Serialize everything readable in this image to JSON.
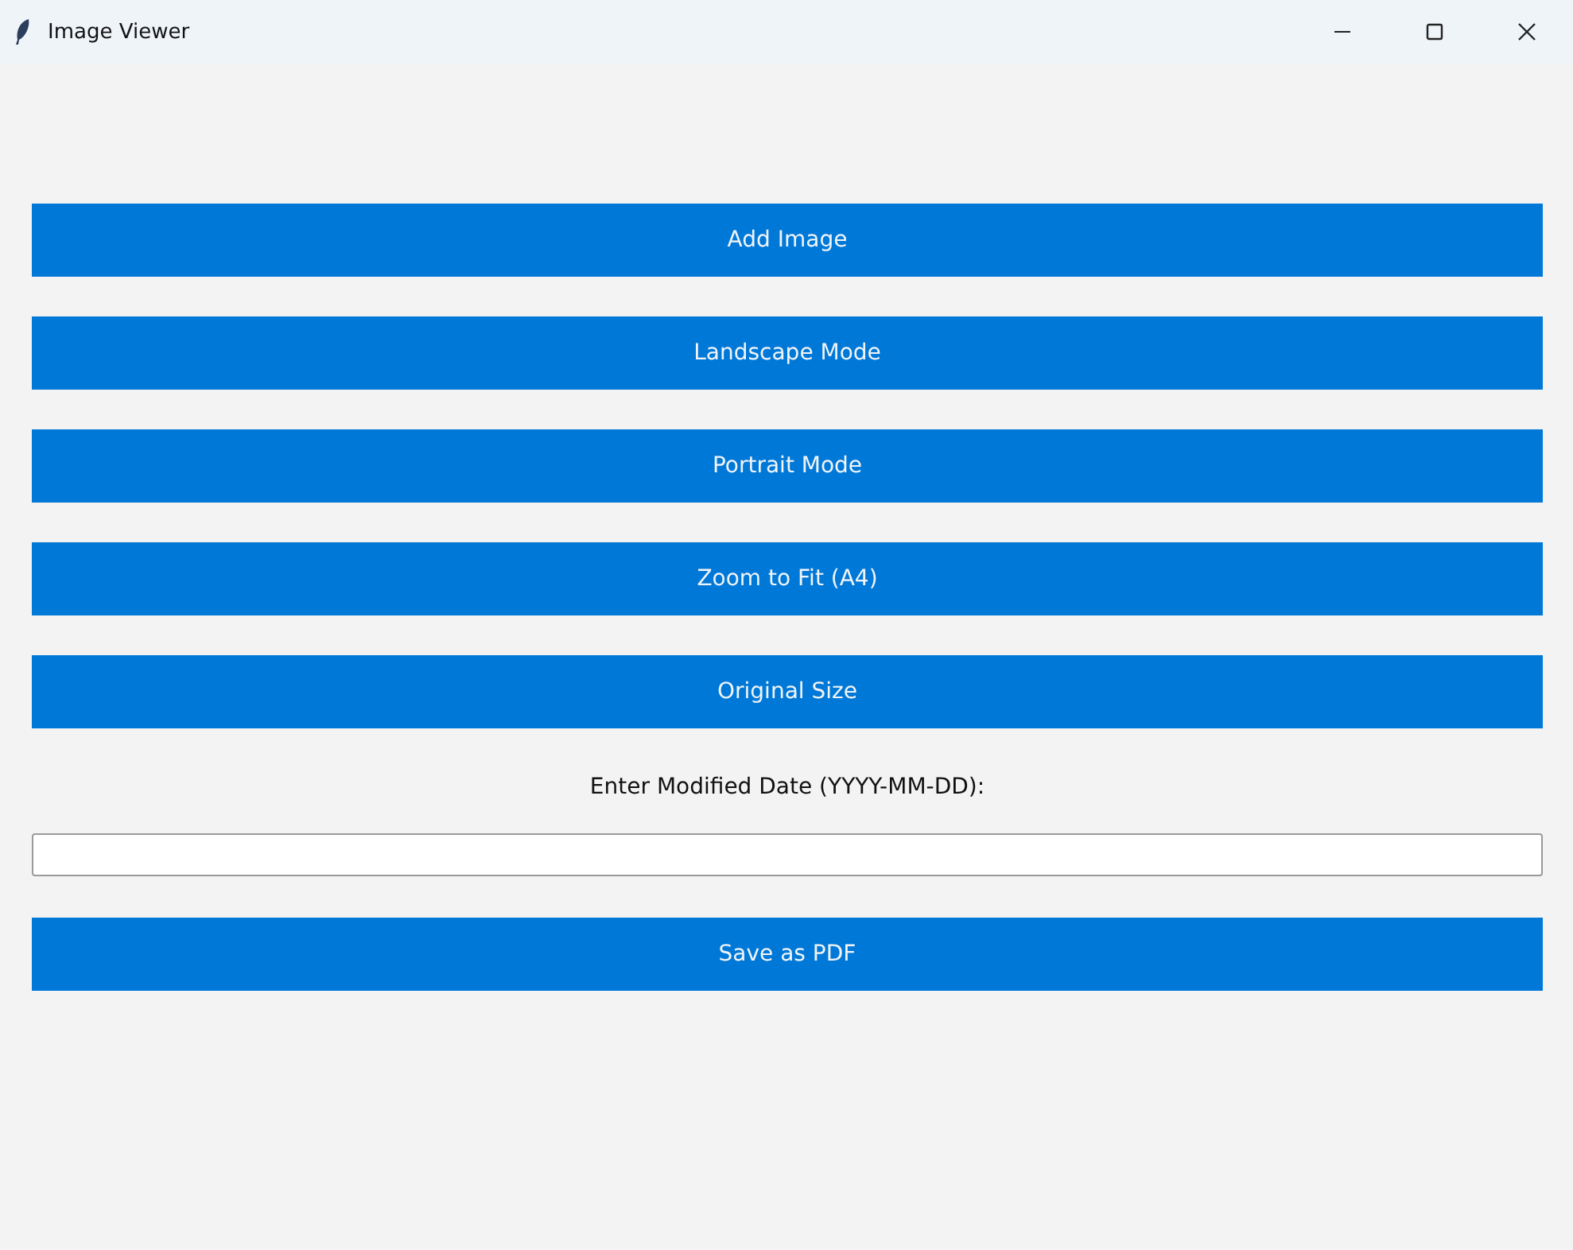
{
  "window": {
    "title": "Image Viewer"
  },
  "controls": [
    {
      "kind": "button",
      "label": "Add Image"
    },
    {
      "kind": "button",
      "label": "Landscape Mode"
    },
    {
      "kind": "button",
      "label": "Portrait Mode"
    },
    {
      "kind": "button",
      "label": "Zoom to Fit (A4)"
    },
    {
      "kind": "button",
      "label": "Original Size"
    },
    {
      "kind": "label",
      "label": "Enter Modified Date (YYYY-MM-DD):"
    },
    {
      "kind": "field"
    },
    {
      "kind": "button",
      "label": "Save as PDF"
    }
  ]
}
